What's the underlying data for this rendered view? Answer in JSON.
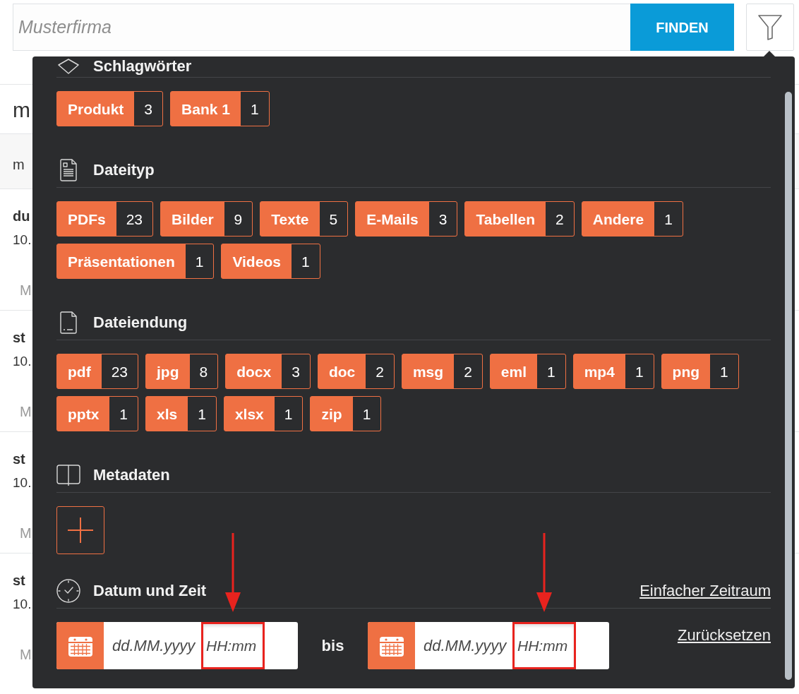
{
  "search": {
    "placeholder": "Musterfirma",
    "button": "FINDEN"
  },
  "background_list": {
    "heading": "m",
    "column_header": "m",
    "rows": [
      {
        "title": "du",
        "date": "10.",
        "detail": "M"
      },
      {
        "title": "st",
        "date": "10.",
        "detail": "M"
      },
      {
        "title": "st",
        "date": "10.",
        "detail": "M"
      },
      {
        "title": "st",
        "date": "10.",
        "detail": "M"
      }
    ]
  },
  "filter_panel": {
    "sections": [
      {
        "kind": "tags",
        "title": "Schlagwörter",
        "tags": [
          {
            "label": "Produkt",
            "count": "3"
          },
          {
            "label": "Bank 1",
            "count": "1"
          }
        ]
      },
      {
        "kind": "tags",
        "title": "Dateityp",
        "tags": [
          {
            "label": "PDFs",
            "count": "23"
          },
          {
            "label": "Bilder",
            "count": "9"
          },
          {
            "label": "Texte",
            "count": "5"
          },
          {
            "label": "E-Mails",
            "count": "3"
          },
          {
            "label": "Tabellen",
            "count": "2"
          },
          {
            "label": "Andere",
            "count": "1"
          },
          {
            "label": "Präsentationen",
            "count": "1"
          },
          {
            "label": "Videos",
            "count": "1"
          }
        ]
      },
      {
        "kind": "tags",
        "title": "Dateiendung",
        "tags": [
          {
            "label": "pdf",
            "count": "23"
          },
          {
            "label": "jpg",
            "count": "8"
          },
          {
            "label": "docx",
            "count": "3"
          },
          {
            "label": "doc",
            "count": "2"
          },
          {
            "label": "msg",
            "count": "2"
          },
          {
            "label": "eml",
            "count": "1"
          },
          {
            "label": "mp4",
            "count": "1"
          },
          {
            "label": "png",
            "count": "1"
          },
          {
            "label": "pptx",
            "count": "1"
          },
          {
            "label": "xls",
            "count": "1"
          },
          {
            "label": "xlsx",
            "count": "1"
          },
          {
            "label": "zip",
            "count": "1"
          }
        ]
      },
      {
        "kind": "add",
        "title": "Metadaten"
      },
      {
        "kind": "daterange",
        "title": "Datum und Zeit",
        "link": "Einfacher Zeitraum",
        "from": {
          "date_placeholder": "dd.MM.yyyy",
          "time_placeholder": "HH:mm",
          "highlighted": true
        },
        "separator": "bis",
        "to": {
          "date_placeholder": "dd.MM.yyyy",
          "time_placeholder": "HH:mm",
          "highlighted": true
        },
        "reset": "Zurücksetzen"
      }
    ]
  }
}
